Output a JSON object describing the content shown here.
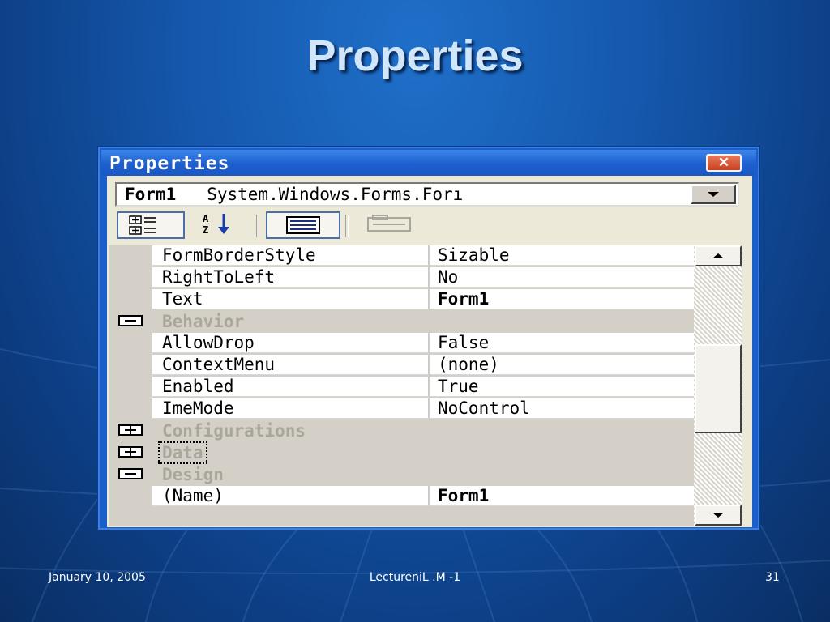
{
  "slide": {
    "title": "Properties",
    "footer": {
      "date": "January 10, 2005",
      "center": "LectureniL .M -1",
      "page": "31"
    }
  },
  "window": {
    "title": "Properties",
    "close_icon": "close-x-icon",
    "object_selector": {
      "name": "Form1",
      "type": "System.Windows.Forms.Forı"
    },
    "toolbar": [
      {
        "icon": "categorized-icon",
        "selected": true
      },
      {
        "icon": "alphabetical-sort-icon",
        "selected": false
      },
      {
        "icon": "properties-list-icon",
        "selected": true
      },
      {
        "icon": "property-pages-icon",
        "selected": false,
        "disabled": true
      }
    ],
    "grid": {
      "rows": [
        {
          "kind": "prop",
          "name": "FormBorderStyle",
          "value": "Sizable",
          "bold": false
        },
        {
          "kind": "prop",
          "name": "RightToLeft",
          "value": "No",
          "bold": false
        },
        {
          "kind": "prop",
          "name": "Text",
          "value": "Form1",
          "bold": true
        },
        {
          "kind": "cat",
          "name": "Behavior",
          "expanded": true
        },
        {
          "kind": "prop",
          "name": "AllowDrop",
          "value": "False",
          "bold": false
        },
        {
          "kind": "prop",
          "name": "ContextMenu",
          "value": "(none)",
          "bold": false
        },
        {
          "kind": "prop",
          "name": "Enabled",
          "value": "True",
          "bold": false
        },
        {
          "kind": "prop",
          "name": "ImeMode",
          "value": "NoControl",
          "bold": false
        },
        {
          "kind": "cat",
          "name": "Configurations",
          "expanded": false
        },
        {
          "kind": "cat",
          "name": "Data",
          "expanded": false,
          "focused": true
        },
        {
          "kind": "cat",
          "name": "Design",
          "expanded": true
        },
        {
          "kind": "prop",
          "name": "(Name)",
          "value": "Form1",
          "bold": true
        }
      ]
    },
    "colors": {
      "titlebar": "#1c5fcf",
      "client": "#ece9d8",
      "category_text": "#a9a69c",
      "close": "#c9421f"
    }
  }
}
